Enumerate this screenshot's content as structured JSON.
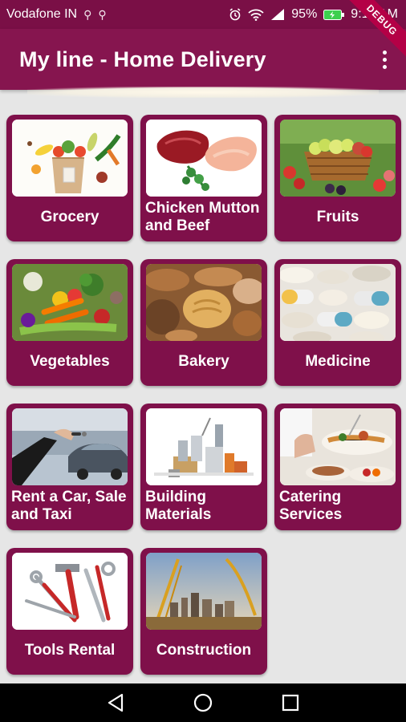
{
  "status_bar": {
    "carrier": "Vodafone IN",
    "battery": "95%",
    "time": "9:13 AM"
  },
  "debug_banner": "DEBUG",
  "app_bar": {
    "title": "My line - Home Delivery"
  },
  "categories": [
    {
      "label": "Grocery",
      "icon": "grocery-image"
    },
    {
      "label": "Chicken Mutton and Beef",
      "icon": "meat-image"
    },
    {
      "label": "Fruits",
      "icon": "fruit-basket-image"
    },
    {
      "label": "Vegetables",
      "icon": "vegetables-image"
    },
    {
      "label": "Bakery",
      "icon": "bread-image"
    },
    {
      "label": "Medicine",
      "icon": "pills-image"
    },
    {
      "label": "Rent a Car, Sale and Taxi",
      "icon": "car-key-image"
    },
    {
      "label": "Building Materials",
      "icon": "building-materials-image"
    },
    {
      "label": "Catering Services",
      "icon": "catering-image"
    },
    {
      "label": "Tools Rental",
      "icon": "tools-image"
    },
    {
      "label": "Construction",
      "icon": "construction-image"
    }
  ],
  "colors": {
    "primary": "#86154f",
    "status_bar": "#7a0f46",
    "tile": "#7f104a",
    "background": "#e6e6e6"
  }
}
